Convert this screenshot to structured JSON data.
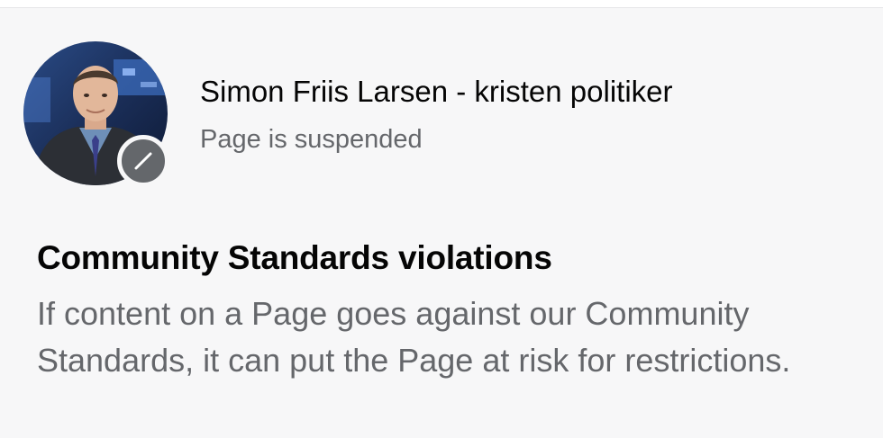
{
  "profile": {
    "name": "Simon Friis Larsen - kristen politiker",
    "status": "Page is suspended",
    "avatar_icon": "profile-photo",
    "badge_icon": "suspended-slash-icon"
  },
  "notice": {
    "heading": "Community Standards violations",
    "body": "If content on a Page goes against our Community Standards, it can put the Page at risk for restrictions."
  },
  "colors": {
    "background": "#f7f7f8",
    "primary_text": "#050505",
    "secondary_text": "#65676b",
    "badge": "#64676b"
  }
}
